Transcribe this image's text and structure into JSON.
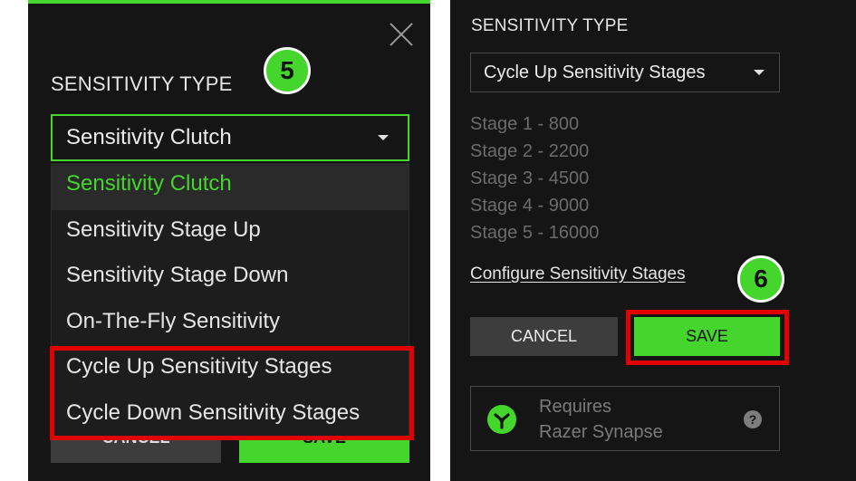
{
  "left_panel": {
    "section_title": "SENSITIVITY TYPE",
    "step_badge": "5",
    "selected_value": "Sensitivity Clutch",
    "dropdown_options": [
      "Sensitivity Clutch",
      "Sensitivity Stage Up",
      "Sensitivity Stage Down",
      "On-The-Fly Sensitivity",
      "Cycle Up Sensitivity Stages",
      "Cycle Down Sensitivity Stages"
    ],
    "cancel_label": "CANCEL",
    "save_label": "SAVE"
  },
  "right_panel": {
    "section_title": "SENSITIVITY TYPE",
    "selected_value": "Cycle Up Sensitivity Stages",
    "stages": [
      "Stage 1 - 800",
      "Stage 2 - 2200",
      "Stage 3 - 4500",
      "Stage 4 - 9000",
      "Stage 5 - 16000"
    ],
    "configure_link": "Configure Sensitivity Stages",
    "step_badge": "6",
    "cancel_label": "CANCEL",
    "save_label": "SAVE",
    "synapse_line1": "Requires",
    "synapse_line2": "Razer Synapse",
    "help_glyph": "?"
  },
  "colors": {
    "accent_green": "#44d62c",
    "highlight_red": "#e00000",
    "panel_bg": "#151515"
  },
  "icons": [
    "close-icon",
    "chevron-down-icon",
    "razer-synapse-icon",
    "help-icon"
  ]
}
